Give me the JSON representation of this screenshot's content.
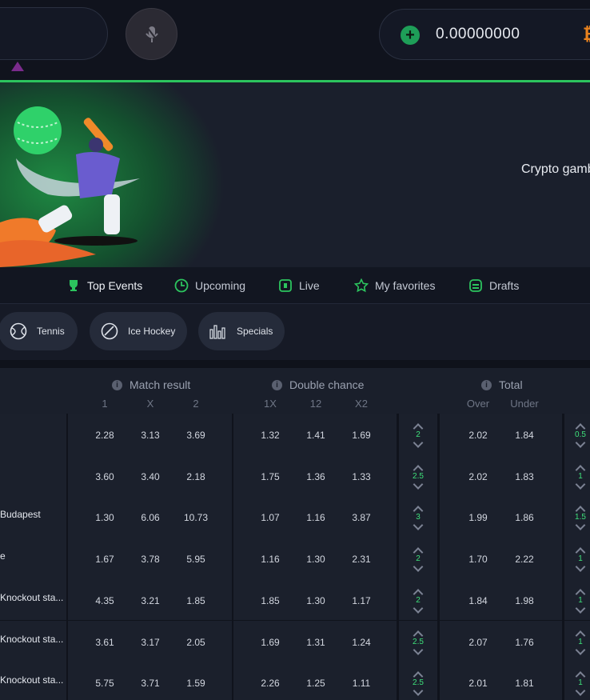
{
  "header": {
    "balance": "0.00000000",
    "currency_icon": "bitcoin-icon",
    "accent": "#2cc45e"
  },
  "banner": {
    "text": "Crypto gamb"
  },
  "tabs": [
    {
      "label": "Top Events",
      "icon": "trophy-icon",
      "active": true
    },
    {
      "label": "Upcoming",
      "icon": "clock-icon"
    },
    {
      "label": "Live",
      "icon": "live-icon"
    },
    {
      "label": "My favorites",
      "icon": "star-icon"
    },
    {
      "label": "Drafts",
      "icon": "drafts-icon"
    }
  ],
  "sports": [
    {
      "label": "Tennis",
      "icon": "tennis-ball-icon"
    },
    {
      "label": "Ice Hockey",
      "icon": "hockey-puck-icon"
    },
    {
      "label": "Specials",
      "icon": "bar-chart-icon"
    }
  ],
  "markets": {
    "match_result": {
      "title": "Match result",
      "cols": [
        "1",
        "X",
        "2"
      ]
    },
    "double_chance": {
      "title": "Double chance",
      "cols": [
        "1X",
        "12",
        "X2"
      ]
    },
    "total": {
      "title": "Total",
      "cols": [
        "Over",
        "Under"
      ]
    }
  },
  "rows": [
    {
      "team": "",
      "mr": [
        "2.28",
        "3.13",
        "3.69"
      ],
      "dc": [
        "1.32",
        "1.41",
        "1.69"
      ],
      "line": "2",
      "tot": [
        "2.02",
        "1.84"
      ],
      "line2": "0.5"
    },
    {
      "team": "",
      "mr": [
        "3.60",
        "3.40",
        "2.18"
      ],
      "dc": [
        "1.75",
        "1.36",
        "1.33"
      ],
      "line": "2.5",
      "tot": [
        "2.02",
        "1.83"
      ],
      "line2": "1"
    },
    {
      "team": "Budapest",
      "mr": [
        "1.30",
        "6.06",
        "10.73"
      ],
      "dc": [
        "1.07",
        "1.16",
        "3.87"
      ],
      "line": "3",
      "tot": [
        "1.99",
        "1.86"
      ],
      "line2": "1.5"
    },
    {
      "team": "e",
      "mr": [
        "1.67",
        "3.78",
        "5.95"
      ],
      "dc": [
        "1.16",
        "1.30",
        "2.31"
      ],
      "line": "2",
      "tot": [
        "1.70",
        "2.22"
      ],
      "line2": "1"
    },
    {
      "team": "Knockout sta...",
      "mr": [
        "4.35",
        "3.21",
        "1.85"
      ],
      "dc": [
        "1.85",
        "1.30",
        "1.17"
      ],
      "line": "2",
      "tot": [
        "1.84",
        "1.98"
      ],
      "line2": "1"
    },
    {
      "team": "Knockout sta...",
      "mr": [
        "3.61",
        "3.17",
        "2.05"
      ],
      "dc": [
        "1.69",
        "1.31",
        "1.24"
      ],
      "line": "2.5",
      "tot": [
        "2.07",
        "1.76"
      ],
      "line2": "1"
    },
    {
      "team": "Knockout sta...",
      "mr": [
        "5.75",
        "3.71",
        "1.59"
      ],
      "dc": [
        "2.26",
        "1.25",
        "1.11"
      ],
      "line": "2.5",
      "tot": [
        "2.01",
        "1.81"
      ],
      "line2": "1"
    }
  ]
}
